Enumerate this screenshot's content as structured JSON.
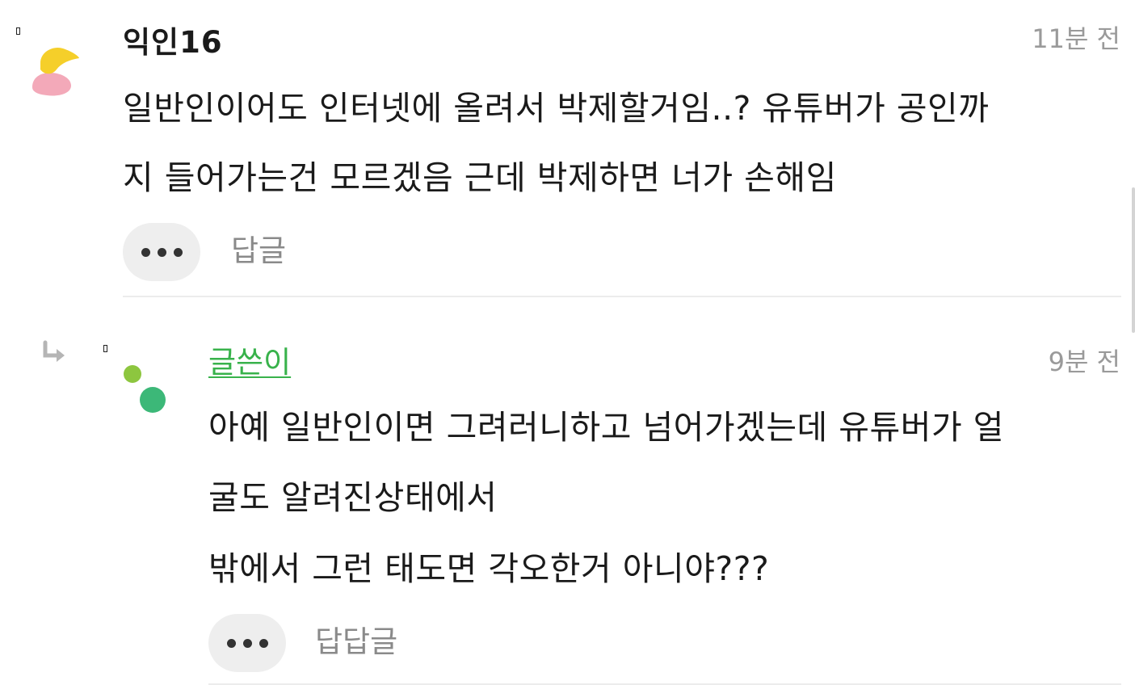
{
  "comment": {
    "author": "익인16",
    "time": "11분 전",
    "lines": [
      "일반인이어도 인터넷에 올려서 박제할거임..? 유튜버가 공인까",
      "지 들어가는건 모르겠음 근데 박제하면 너가 손해임"
    ],
    "reply_label": "답글",
    "avatar_colors": [
      "#f5cf2a",
      "#f3a9b9"
    ]
  },
  "reply": {
    "author": "글쓴이",
    "time": "9분 전",
    "lines": [
      "아예 일반인이면 그려러니하고 넘어가겠는데 유튜버가 얼",
      "굴도 알려진상태에서",
      "밖에서 그런 태도면 각오한거 아니야???"
    ],
    "reply_label": "답답글",
    "avatar_colors": [
      "#8dc63f",
      "#3cb878"
    ]
  },
  "colors": {
    "writer_accent": "#38b24b",
    "muted": "#9a9a9a",
    "button_bg": "#eeeeee"
  },
  "icons": {
    "bookmark": "bookmark-icon",
    "reply_arrow": "reply-arrow-icon",
    "more": "more-dots-icon"
  }
}
